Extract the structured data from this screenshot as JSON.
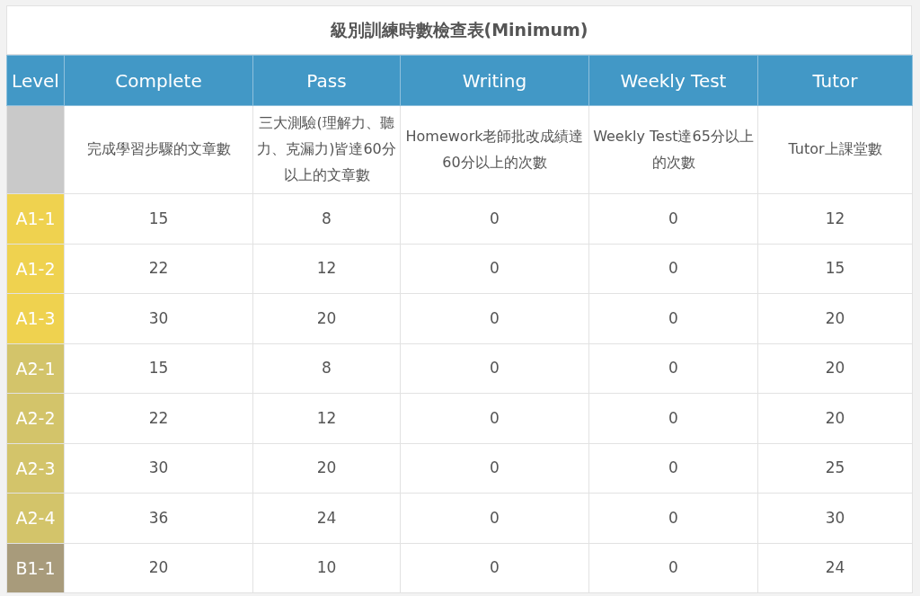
{
  "title": "級別訓練時數檢查表(Minimum)",
  "columns": [
    "Level",
    "Complete",
    "Pass",
    "Writing",
    "Weekly Test",
    "Tutor"
  ],
  "descriptions": [
    "完成學習步驟的文章數",
    "三大測驗(理解力、聽力、克漏力)皆達60分以上的文章數",
    "Homework老師批改成績達60分以上的次數",
    "Weekly Test達65分以上的次數",
    "Tutor上課堂數"
  ],
  "rows": [
    {
      "level": "A1-1",
      "color": "#efd24f",
      "values": [
        "15",
        "8",
        "0",
        "0",
        "12"
      ]
    },
    {
      "level": "A1-2",
      "color": "#efd24f",
      "values": [
        "22",
        "12",
        "0",
        "0",
        "15"
      ]
    },
    {
      "level": "A1-3",
      "color": "#efd24f",
      "values": [
        "30",
        "20",
        "0",
        "0",
        "20"
      ]
    },
    {
      "level": "A2-1",
      "color": "#d3c46a",
      "values": [
        "15",
        "8",
        "0",
        "0",
        "20"
      ]
    },
    {
      "level": "A2-2",
      "color": "#d3c46a",
      "values": [
        "22",
        "12",
        "0",
        "0",
        "20"
      ]
    },
    {
      "level": "A2-3",
      "color": "#d3c46a",
      "values": [
        "30",
        "20",
        "0",
        "0",
        "25"
      ]
    },
    {
      "level": "A2-4",
      "color": "#d3c46a",
      "values": [
        "36",
        "24",
        "0",
        "0",
        "30"
      ]
    },
    {
      "level": "B1-1",
      "color": "#a89b7b",
      "values": [
        "20",
        "10",
        "0",
        "0",
        "24"
      ]
    }
  ]
}
